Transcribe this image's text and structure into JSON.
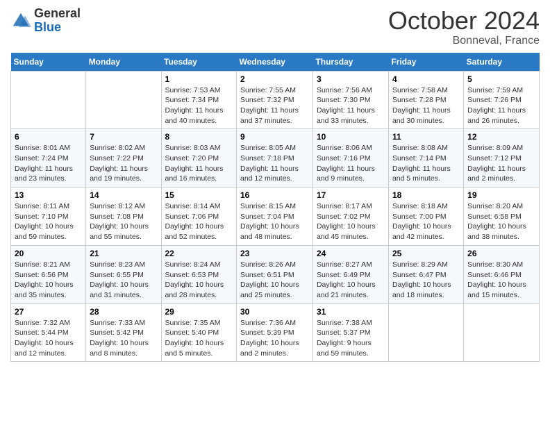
{
  "header": {
    "logo_general": "General",
    "logo_blue": "Blue",
    "month_title": "October 2024",
    "location": "Bonneval, France"
  },
  "weekdays": [
    "Sunday",
    "Monday",
    "Tuesday",
    "Wednesday",
    "Thursday",
    "Friday",
    "Saturday"
  ],
  "weeks": [
    [
      {
        "day": "",
        "info": ""
      },
      {
        "day": "",
        "info": ""
      },
      {
        "day": "1",
        "info": "Sunrise: 7:53 AM\nSunset: 7:34 PM\nDaylight: 11 hours and 40 minutes."
      },
      {
        "day": "2",
        "info": "Sunrise: 7:55 AM\nSunset: 7:32 PM\nDaylight: 11 hours and 37 minutes."
      },
      {
        "day": "3",
        "info": "Sunrise: 7:56 AM\nSunset: 7:30 PM\nDaylight: 11 hours and 33 minutes."
      },
      {
        "day": "4",
        "info": "Sunrise: 7:58 AM\nSunset: 7:28 PM\nDaylight: 11 hours and 30 minutes."
      },
      {
        "day": "5",
        "info": "Sunrise: 7:59 AM\nSunset: 7:26 PM\nDaylight: 11 hours and 26 minutes."
      }
    ],
    [
      {
        "day": "6",
        "info": "Sunrise: 8:01 AM\nSunset: 7:24 PM\nDaylight: 11 hours and 23 minutes."
      },
      {
        "day": "7",
        "info": "Sunrise: 8:02 AM\nSunset: 7:22 PM\nDaylight: 11 hours and 19 minutes."
      },
      {
        "day": "8",
        "info": "Sunrise: 8:03 AM\nSunset: 7:20 PM\nDaylight: 11 hours and 16 minutes."
      },
      {
        "day": "9",
        "info": "Sunrise: 8:05 AM\nSunset: 7:18 PM\nDaylight: 11 hours and 12 minutes."
      },
      {
        "day": "10",
        "info": "Sunrise: 8:06 AM\nSunset: 7:16 PM\nDaylight: 11 hours and 9 minutes."
      },
      {
        "day": "11",
        "info": "Sunrise: 8:08 AM\nSunset: 7:14 PM\nDaylight: 11 hours and 5 minutes."
      },
      {
        "day": "12",
        "info": "Sunrise: 8:09 AM\nSunset: 7:12 PM\nDaylight: 11 hours and 2 minutes."
      }
    ],
    [
      {
        "day": "13",
        "info": "Sunrise: 8:11 AM\nSunset: 7:10 PM\nDaylight: 10 hours and 59 minutes."
      },
      {
        "day": "14",
        "info": "Sunrise: 8:12 AM\nSunset: 7:08 PM\nDaylight: 10 hours and 55 minutes."
      },
      {
        "day": "15",
        "info": "Sunrise: 8:14 AM\nSunset: 7:06 PM\nDaylight: 10 hours and 52 minutes."
      },
      {
        "day": "16",
        "info": "Sunrise: 8:15 AM\nSunset: 7:04 PM\nDaylight: 10 hours and 48 minutes."
      },
      {
        "day": "17",
        "info": "Sunrise: 8:17 AM\nSunset: 7:02 PM\nDaylight: 10 hours and 45 minutes."
      },
      {
        "day": "18",
        "info": "Sunrise: 8:18 AM\nSunset: 7:00 PM\nDaylight: 10 hours and 42 minutes."
      },
      {
        "day": "19",
        "info": "Sunrise: 8:20 AM\nSunset: 6:58 PM\nDaylight: 10 hours and 38 minutes."
      }
    ],
    [
      {
        "day": "20",
        "info": "Sunrise: 8:21 AM\nSunset: 6:56 PM\nDaylight: 10 hours and 35 minutes."
      },
      {
        "day": "21",
        "info": "Sunrise: 8:23 AM\nSunset: 6:55 PM\nDaylight: 10 hours and 31 minutes."
      },
      {
        "day": "22",
        "info": "Sunrise: 8:24 AM\nSunset: 6:53 PM\nDaylight: 10 hours and 28 minutes."
      },
      {
        "day": "23",
        "info": "Sunrise: 8:26 AM\nSunset: 6:51 PM\nDaylight: 10 hours and 25 minutes."
      },
      {
        "day": "24",
        "info": "Sunrise: 8:27 AM\nSunset: 6:49 PM\nDaylight: 10 hours and 21 minutes."
      },
      {
        "day": "25",
        "info": "Sunrise: 8:29 AM\nSunset: 6:47 PM\nDaylight: 10 hours and 18 minutes."
      },
      {
        "day": "26",
        "info": "Sunrise: 8:30 AM\nSunset: 6:46 PM\nDaylight: 10 hours and 15 minutes."
      }
    ],
    [
      {
        "day": "27",
        "info": "Sunrise: 7:32 AM\nSunset: 5:44 PM\nDaylight: 10 hours and 12 minutes."
      },
      {
        "day": "28",
        "info": "Sunrise: 7:33 AM\nSunset: 5:42 PM\nDaylight: 10 hours and 8 minutes."
      },
      {
        "day": "29",
        "info": "Sunrise: 7:35 AM\nSunset: 5:40 PM\nDaylight: 10 hours and 5 minutes."
      },
      {
        "day": "30",
        "info": "Sunrise: 7:36 AM\nSunset: 5:39 PM\nDaylight: 10 hours and 2 minutes."
      },
      {
        "day": "31",
        "info": "Sunrise: 7:38 AM\nSunset: 5:37 PM\nDaylight: 9 hours and 59 minutes."
      },
      {
        "day": "",
        "info": ""
      },
      {
        "day": "",
        "info": ""
      }
    ]
  ]
}
